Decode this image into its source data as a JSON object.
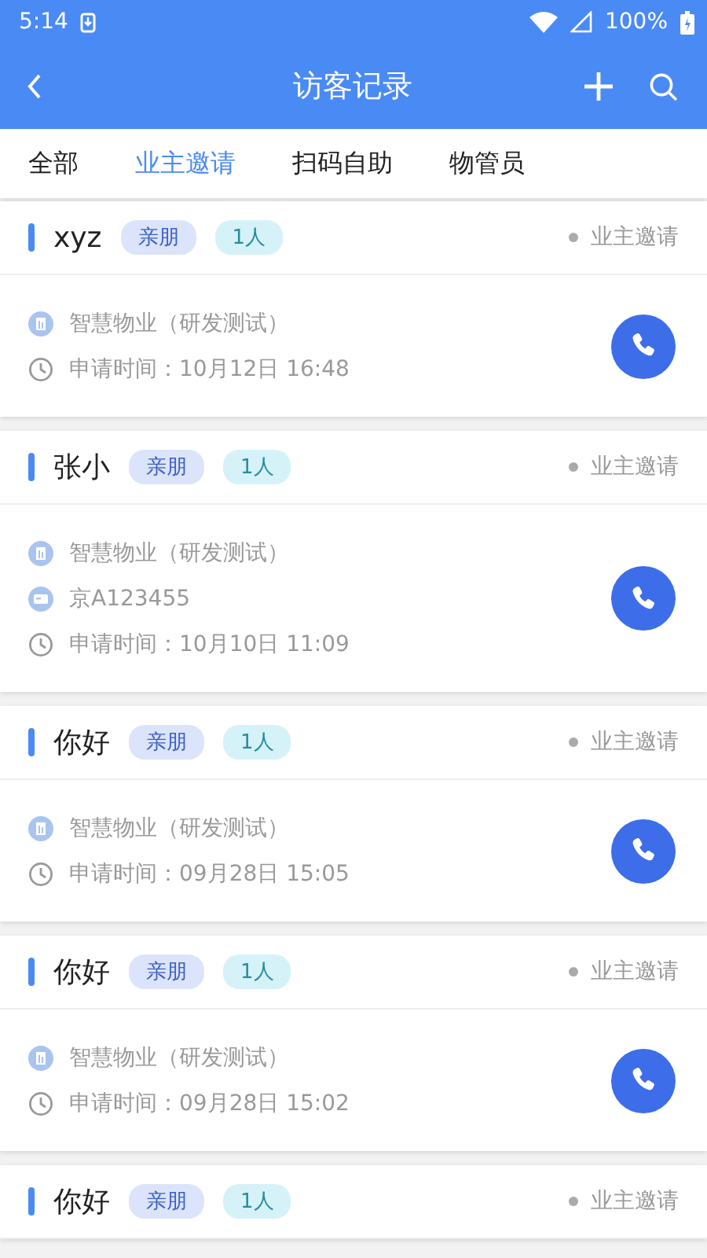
{
  "status_bar": {
    "time": "5:14",
    "battery": "100%"
  },
  "header": {
    "title": "访客记录"
  },
  "tabs": [
    {
      "label": "全部",
      "selected": false
    },
    {
      "label": "业主邀请",
      "selected": true
    },
    {
      "label": "扫码自助",
      "selected": false
    },
    {
      "label": "物管员",
      "selected": false
    }
  ],
  "records": [
    {
      "name": "xyz",
      "relation": "亲朋",
      "count": "1人",
      "source": "业主邀请",
      "lines": [
        {
          "kind": "company",
          "text": "智慧物业（研发测试）"
        },
        {
          "kind": "time",
          "text": "申请时间：10月12日 16:48"
        }
      ]
    },
    {
      "name": "张小",
      "relation": "亲朋",
      "count": "1人",
      "source": "业主邀请",
      "lines": [
        {
          "kind": "company",
          "text": "智慧物业（研发测试）"
        },
        {
          "kind": "plate",
          "text": "京A123455"
        },
        {
          "kind": "time",
          "text": "申请时间：10月10日 11:09"
        }
      ]
    },
    {
      "name": "你好",
      "relation": "亲朋",
      "count": "1人",
      "source": "业主邀请",
      "lines": [
        {
          "kind": "company",
          "text": "智慧物业（研发测试）"
        },
        {
          "kind": "time",
          "text": "申请时间：09月28日 15:05"
        }
      ]
    },
    {
      "name": "你好",
      "relation": "亲朋",
      "count": "1人",
      "source": "业主邀请",
      "lines": [
        {
          "kind": "company",
          "text": "智慧物业（研发测试）"
        },
        {
          "kind": "time",
          "text": "申请时间：09月28日 15:02"
        }
      ]
    },
    {
      "name": "你好",
      "relation": "亲朋",
      "count": "1人",
      "source": "业主邀请"
    }
  ]
}
